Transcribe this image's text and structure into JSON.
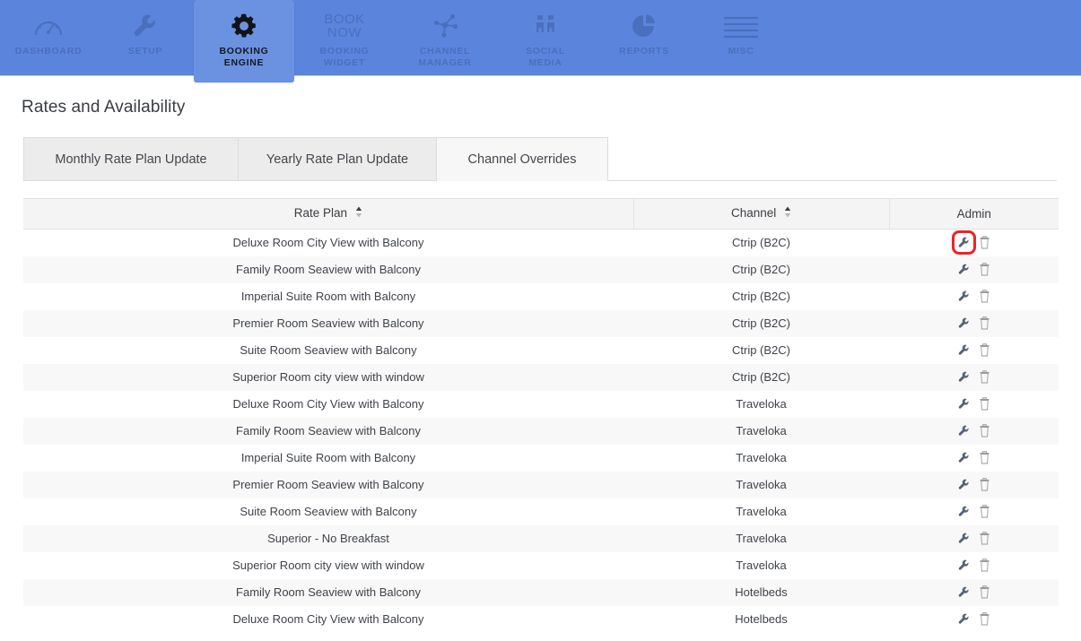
{
  "nav": {
    "items": [
      {
        "id": "dashboard",
        "label": "DASHBOARD",
        "icon": "gauge-icon",
        "active": false
      },
      {
        "id": "setup",
        "label": "SETUP",
        "icon": "wrench-icon",
        "active": false
      },
      {
        "id": "booking-engine",
        "label": "BOOKING\nENGINE",
        "icon": "gear-icon",
        "active": true
      },
      {
        "id": "booking-widget",
        "label": "BOOKING\nWIDGET",
        "icon": "book-now-text-icon",
        "active": false
      },
      {
        "id": "channel-manager",
        "label": "CHANNEL\nMANAGER",
        "icon": "network-nodes-icon",
        "active": false
      },
      {
        "id": "social-media",
        "label": "SOCIAL\nMEDIA",
        "icon": "two-people-icon",
        "active": false
      },
      {
        "id": "reports",
        "label": "REPORTS",
        "icon": "pie-chart-icon",
        "active": false
      },
      {
        "id": "misc",
        "label": "MISC",
        "icon": "hamburger-lines-icon",
        "active": false
      }
    ],
    "booking_widget_glyph": "BOOK\nNOW"
  },
  "page": {
    "title": "Rates and Availability"
  },
  "tabs": [
    {
      "id": "monthly-rate-plan-update",
      "label": "Monthly Rate Plan Update",
      "active": false
    },
    {
      "id": "yearly-rate-plan-update",
      "label": "Yearly Rate Plan Update",
      "active": false
    },
    {
      "id": "channel-overrides",
      "label": "Channel Overrides",
      "active": true
    }
  ],
  "table": {
    "columns": [
      {
        "id": "rate-plan",
        "label": "Rate Plan",
        "sortable": true
      },
      {
        "id": "channel",
        "label": "Channel",
        "sortable": true
      },
      {
        "id": "admin",
        "label": "Admin",
        "sortable": false
      }
    ],
    "row_actions": [
      {
        "id": "edit",
        "icon": "wrench-icon"
      },
      {
        "id": "delete",
        "icon": "trash-icon"
      }
    ],
    "rows": [
      {
        "rate_plan": "Deluxe Room City View with Balcony",
        "channel": "Ctrip (B2C)",
        "highlight_edit": true
      },
      {
        "rate_plan": "Family Room Seaview with Balcony",
        "channel": "Ctrip (B2C)",
        "highlight_edit": false
      },
      {
        "rate_plan": "Imperial Suite Room with Balcony",
        "channel": "Ctrip (B2C)",
        "highlight_edit": false
      },
      {
        "rate_plan": "Premier Room Seaview with Balcony",
        "channel": "Ctrip (B2C)",
        "highlight_edit": false
      },
      {
        "rate_plan": "Suite Room Seaview with Balcony",
        "channel": "Ctrip (B2C)",
        "highlight_edit": false
      },
      {
        "rate_plan": "Superior Room city view with window",
        "channel": "Ctrip (B2C)",
        "highlight_edit": false
      },
      {
        "rate_plan": "Deluxe Room City View with Balcony",
        "channel": "Traveloka",
        "highlight_edit": false
      },
      {
        "rate_plan": "Family Room Seaview with Balcony",
        "channel": "Traveloka",
        "highlight_edit": false
      },
      {
        "rate_plan": "Imperial Suite Room with Balcony",
        "channel": "Traveloka",
        "highlight_edit": false
      },
      {
        "rate_plan": "Premier Room Seaview with Balcony",
        "channel": "Traveloka",
        "highlight_edit": false
      },
      {
        "rate_plan": "Suite Room Seaview with Balcony",
        "channel": "Traveloka",
        "highlight_edit": false
      },
      {
        "rate_plan": "Superior - No Breakfast",
        "channel": "Traveloka",
        "highlight_edit": false
      },
      {
        "rate_plan": "Superior Room city view with window",
        "channel": "Traveloka",
        "highlight_edit": false
      },
      {
        "rate_plan": "Family Room Seaview with Balcony",
        "channel": "Hotelbeds",
        "highlight_edit": false
      },
      {
        "rate_plan": "Deluxe Room City View with Balcony",
        "channel": "Hotelbeds",
        "highlight_edit": false
      }
    ]
  },
  "colors": {
    "nav_blue": "#5b85dd",
    "nav_active_blue": "#6b92e0",
    "nav_label": "#4a6fbd",
    "highlight_red": "#ee2327",
    "tab_inactive": "#ececec",
    "tab_active": "#f7f7f7",
    "row_stripe": "#f8f8f8",
    "header_bg": "#f4f4f4"
  }
}
